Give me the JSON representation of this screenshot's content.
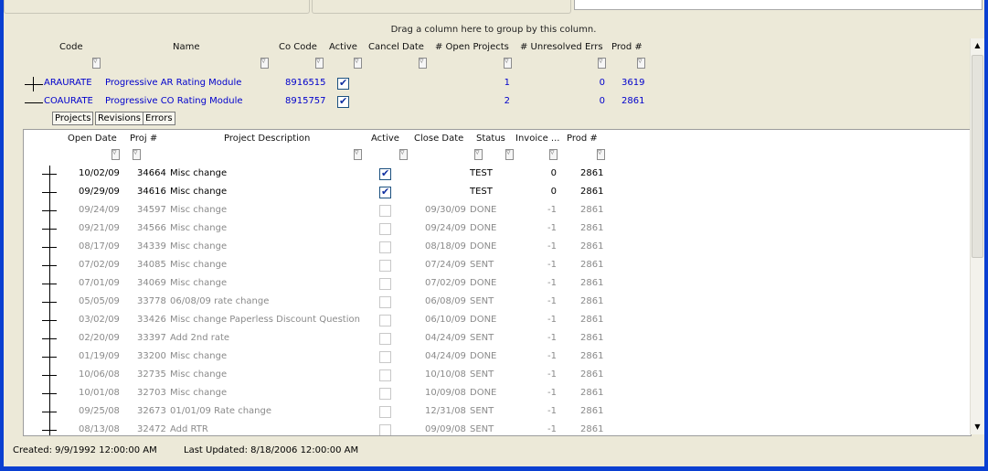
{
  "group_hint": "Drag a column here to group by this column.",
  "columns": {
    "code": "Code",
    "name": "Name",
    "co_code": "Co Code",
    "active": "Active",
    "cancel_date": "Cancel Date",
    "open_projects": "# Open Projects",
    "unresolved_errs": "# Unresolved Errs",
    "prod": "Prod #"
  },
  "parent_rows": [
    {
      "code": "ARAURATE",
      "name": "Progressive AR Rating Module",
      "co_code": "8916515",
      "active": true,
      "cancel_date": "",
      "open_projects": "1",
      "unresolved_errs": "0",
      "prod": "3619",
      "expanded": false
    },
    {
      "code": "COAURATE",
      "name": "Progressive CO Rating Module",
      "co_code": "8915757",
      "active": true,
      "cancel_date": "",
      "open_projects": "2",
      "unresolved_errs": "0",
      "prod": "2861",
      "expanded": true
    }
  ],
  "tabs": [
    "Projects",
    "Revisions",
    "Errors"
  ],
  "child_columns": {
    "open_date": "Open Date",
    "proj": "Proj #",
    "desc": "Project Description",
    "active": "Active",
    "close_date": "Close Date",
    "status": "Status",
    "invoice": "Invoice ...",
    "prod": "Prod #"
  },
  "child_rows": [
    {
      "open_date": "10/02/09",
      "proj": "34664",
      "desc": "Misc change",
      "active": true,
      "close_date": "",
      "status": "TEST",
      "invoice": "0",
      "prod": "2861"
    },
    {
      "open_date": "09/29/09",
      "proj": "34616",
      "desc": "Misc change",
      "active": true,
      "close_date": "",
      "status": "TEST",
      "invoice": "0",
      "prod": "2861"
    },
    {
      "open_date": "09/24/09",
      "proj": "34597",
      "desc": "Misc change",
      "active": false,
      "close_date": "09/30/09",
      "status": "DONE",
      "invoice": "-1",
      "prod": "2861"
    },
    {
      "open_date": "09/21/09",
      "proj": "34566",
      "desc": "Misc change",
      "active": false,
      "close_date": "09/24/09",
      "status": "DONE",
      "invoice": "-1",
      "prod": "2861"
    },
    {
      "open_date": "08/17/09",
      "proj": "34339",
      "desc": "Misc change",
      "active": false,
      "close_date": "08/18/09",
      "status": "DONE",
      "invoice": "-1",
      "prod": "2861"
    },
    {
      "open_date": "07/02/09",
      "proj": "34085",
      "desc": "Misc change",
      "active": false,
      "close_date": "07/24/09",
      "status": "SENT",
      "invoice": "-1",
      "prod": "2861"
    },
    {
      "open_date": "07/01/09",
      "proj": "34069",
      "desc": "Misc change",
      "active": false,
      "close_date": "07/02/09",
      "status": "DONE",
      "invoice": "-1",
      "prod": "2861"
    },
    {
      "open_date": "05/05/09",
      "proj": "33778",
      "desc": "06/08/09 rate change",
      "active": false,
      "close_date": "06/08/09",
      "status": "SENT",
      "invoice": "-1",
      "prod": "2861"
    },
    {
      "open_date": "03/02/09",
      "proj": "33426",
      "desc": "Misc change Paperless Discount Question",
      "active": false,
      "close_date": "06/10/09",
      "status": "DONE",
      "invoice": "-1",
      "prod": "2861"
    },
    {
      "open_date": "02/20/09",
      "proj": "33397",
      "desc": "Add 2nd rate",
      "active": false,
      "close_date": "04/24/09",
      "status": "SENT",
      "invoice": "-1",
      "prod": "2861"
    },
    {
      "open_date": "01/19/09",
      "proj": "33200",
      "desc": "Misc change",
      "active": false,
      "close_date": "04/24/09",
      "status": "DONE",
      "invoice": "-1",
      "prod": "2861"
    },
    {
      "open_date": "10/06/08",
      "proj": "32735",
      "desc": "Misc change",
      "active": false,
      "close_date": "10/10/08",
      "status": "SENT",
      "invoice": "-1",
      "prod": "2861"
    },
    {
      "open_date": "10/01/08",
      "proj": "32703",
      "desc": "Misc change",
      "active": false,
      "close_date": "10/09/08",
      "status": "DONE",
      "invoice": "-1",
      "prod": "2861"
    },
    {
      "open_date": "09/25/08",
      "proj": "32673",
      "desc": "01/01/09 Rate change",
      "active": false,
      "close_date": "12/31/08",
      "status": "SENT",
      "invoice": "-1",
      "prod": "2861"
    },
    {
      "open_date": "08/13/08",
      "proj": "32472",
      "desc": "Add RTR",
      "active": false,
      "close_date": "09/09/08",
      "status": "SENT",
      "invoice": "-1",
      "prod": "2861"
    }
  ],
  "status_bar": {
    "created": "Created: 9/9/1992 12:00:00 AM",
    "updated": "Last Updated: 8/18/2006 12:00:00 AM"
  },
  "scrollbar": {
    "up_icon": "up-arrow-icon",
    "down_icon": "down-arrow-icon"
  }
}
